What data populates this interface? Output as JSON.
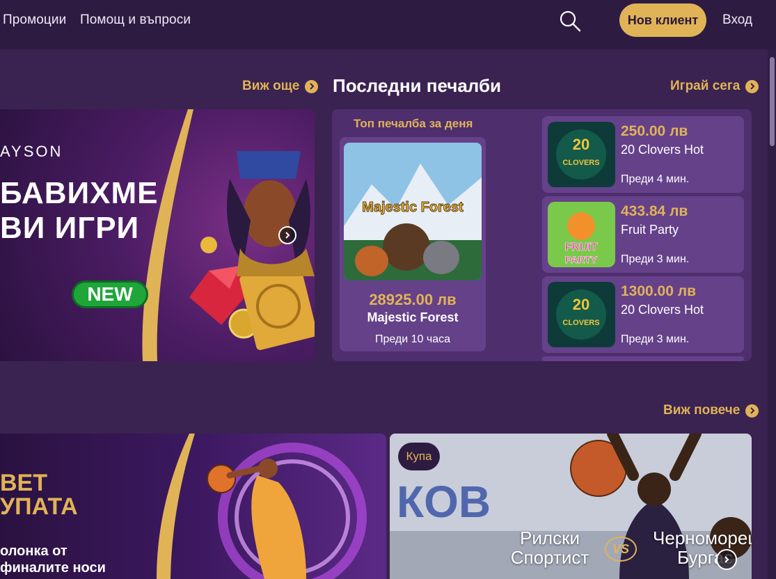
{
  "header": {
    "nav": [
      "Промоции",
      "Помощ и въпроси"
    ],
    "register_label": "Нов клиент",
    "login_label": "Вход"
  },
  "promo": {
    "see_more": "Виж още",
    "brand": "AYSON",
    "line1": "БАВИХМЕ",
    "line2": "ВИ ИГРИ",
    "badge": "NEW"
  },
  "winnings": {
    "title": "Последни печалби",
    "play_now": "Играй сега",
    "top_label": "Топ печалба за деня",
    "top": {
      "amount": "28925.00 лв",
      "game": "Majestic Forest",
      "time": "Преди 10 часа",
      "thumb_text": "Majestic Forest"
    },
    "items": [
      {
        "amount": "250.00 лв",
        "game": "20 Clovers Hot",
        "time": "Преди 4 мин."
      },
      {
        "amount": "433.84 лв",
        "game": "Fruit Party",
        "time": "Преди 3 мин."
      },
      {
        "amount": "1300.00 лв",
        "game": "20 Clovers Hot",
        "time": "Преди 3 мин."
      }
    ]
  },
  "sports": {
    "see_more": "Виж повече",
    "banner": {
      "line1": "BET",
      "line2": "УПАТА",
      "sub1": "олонка от",
      "sub2": "финалите носи"
    },
    "match": {
      "badge": "Купа",
      "team1_a": "Рилски",
      "team1_b": "Спортист",
      "team2_a": "Черноморец",
      "team2_b": "Бургас",
      "vs": "VS",
      "wall_text": "КОВ"
    }
  },
  "colors": {
    "accent": "#e0b357",
    "bg": "#3a2350",
    "header": "#2e1b42",
    "card": "#65418a"
  }
}
